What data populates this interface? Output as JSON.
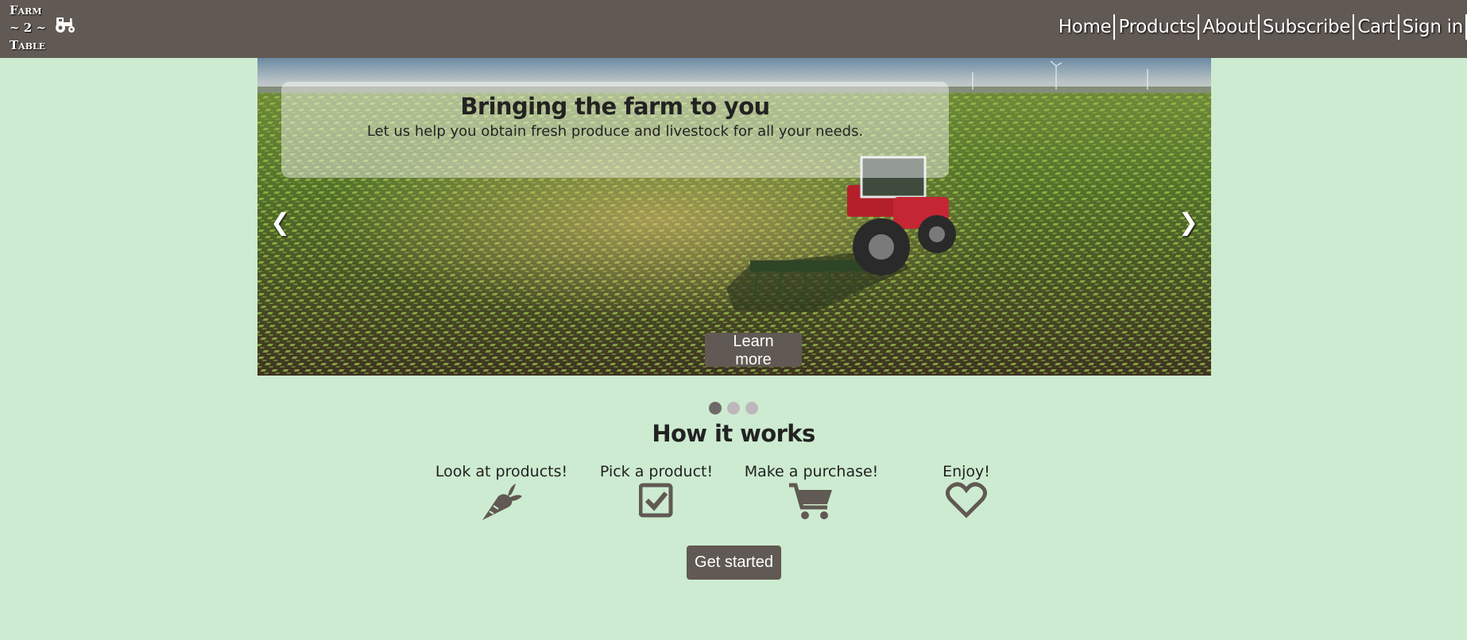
{
  "header": {
    "logo_lines": [
      "Farm",
      "~ 2 ~",
      "Table"
    ],
    "logo_icon": "tractor-icon",
    "nav": [
      {
        "label": "Home"
      },
      {
        "label": "Products"
      },
      {
        "label": "About"
      },
      {
        "label": "Subscribe"
      },
      {
        "label": "Cart"
      },
      {
        "label": "Sign in"
      }
    ]
  },
  "carousel": {
    "title": "Bringing the farm to you",
    "subtitle": "Let us help you obtain fresh produce and livestock for all your needs.",
    "prev_arrow": "❮",
    "next_arrow": "❯",
    "button_label": "Learn more",
    "slide_count": 3,
    "active_slide": 1
  },
  "how_it_works": {
    "title": "How it works",
    "steps": [
      {
        "label": "Look at products!",
        "icon": "carrot-icon"
      },
      {
        "label": "Pick a product!",
        "icon": "checkbox-icon"
      },
      {
        "label": "Make a purchase!",
        "icon": "cart-icon"
      },
      {
        "label": "Enjoy!",
        "icon": "heart-icon"
      }
    ],
    "button_label": "Get started"
  },
  "colors": {
    "background": "#cdebd0",
    "header": "#615953",
    "button": "#615953",
    "icon": "#615953"
  }
}
